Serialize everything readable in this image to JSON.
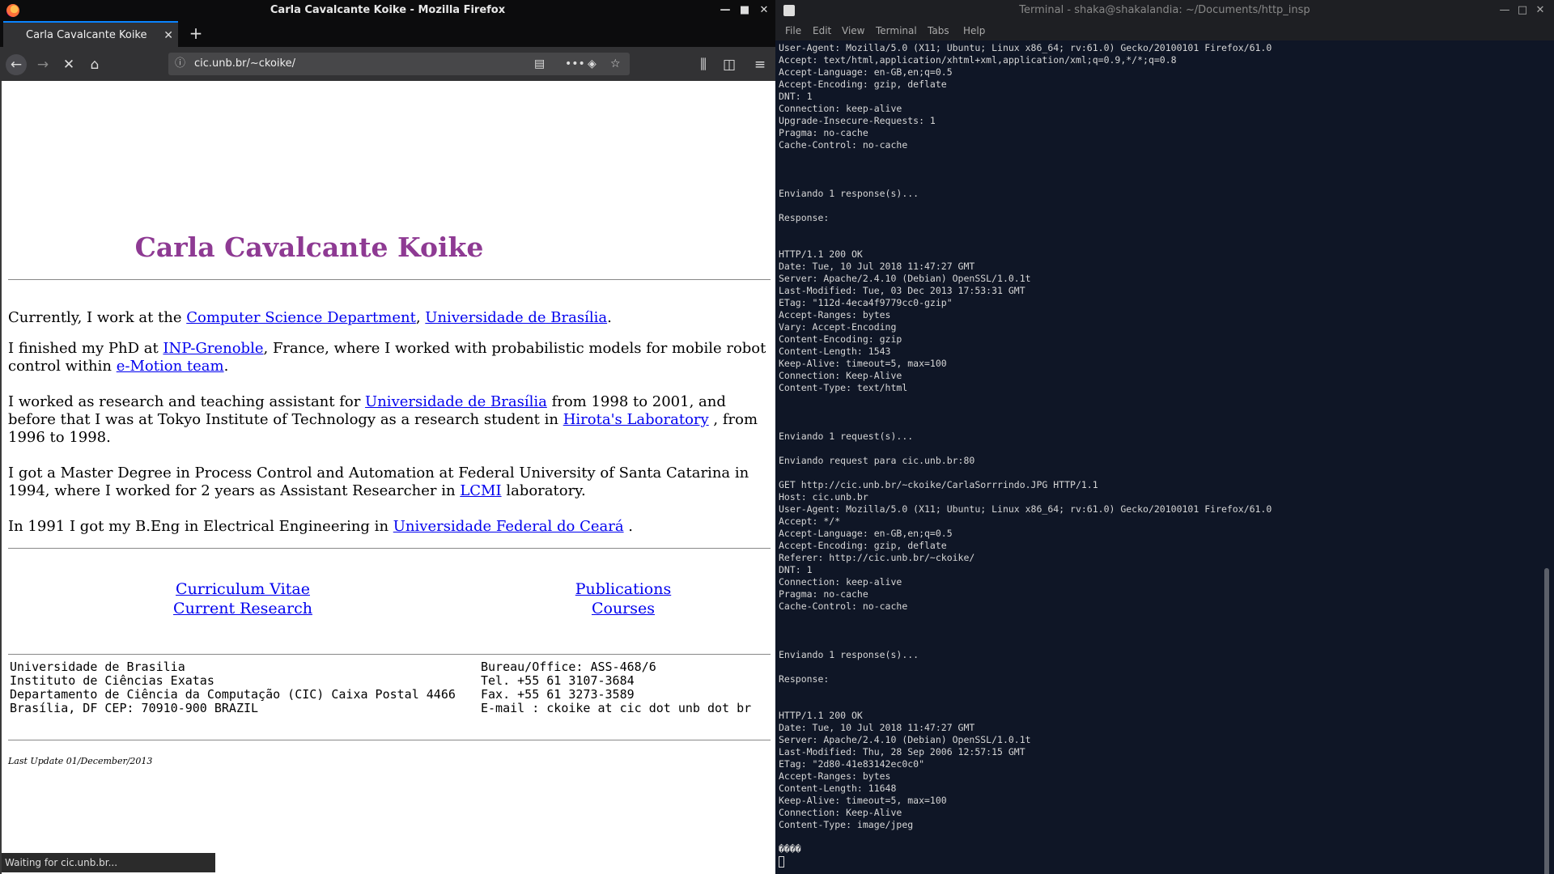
{
  "firefox": {
    "window_title": "Carla Cavalcante Koike - Mozilla Firefox",
    "tab_title": "Carla Cavalcante Koike",
    "url": "cic.unb.br/~ckoike/",
    "status": "Waiting for cic.unb.br..."
  },
  "page": {
    "heading": "Carla Cavalcante Koike",
    "p1": [
      "Currently, I work at the ",
      "Computer Science Department",
      ", ",
      "Universidade de Brasília",
      "."
    ],
    "p2": [
      "I finished my PhD at ",
      "INP-Grenoble",
      ", France, where I worked with probabilistic models for mobile robot control within ",
      "e-Motion team",
      "."
    ],
    "p3": [
      "I worked as research and teaching assistant for ",
      "Universidade de Brasília",
      " from 1998 to 2001, and before that I was at Tokyo Institute of Technology as a research student in ",
      "Hirota's Laboratory",
      " , from 1996 to 1998."
    ],
    "p4": [
      "I got a Master Degree in Process Control and Automation at Federal University of Santa Catarina in 1994, where I worked for 2 years as Assistant Researcher in ",
      "LCMI",
      " laboratory."
    ],
    "p5": [
      "In 1991 I got my B.Eng in Electrical Engineering in ",
      "Universidade Federal do Ceará",
      " ."
    ],
    "links_left": [
      "Curriculum Vitae",
      "Current Research"
    ],
    "links_right": [
      "Publications",
      "Courses"
    ],
    "footer_left": [
      "Universidade de Brasilia",
      "Instituto de Ciências Exatas",
      "Departamento de Ciência da Computação (CIC) Caixa Postal 4466",
      "Brasília, DF CEP: 70910-900 BRAZIL"
    ],
    "footer_right": [
      "Bureau/Office: ASS-468/6",
      "Tel. +55 61 3107-3684",
      "Fax. +55 61 3273-3589",
      "E-mail : ckoike at cic dot unb dot br"
    ],
    "last_update": "Last Update 01/December/2013"
  },
  "terminal": {
    "window_title": "Terminal - shaka@shakalandia: ~/Documents/http_insp",
    "menu": [
      "File",
      "Edit",
      "View",
      "Terminal",
      "Tabs",
      "Help"
    ],
    "lines": [
      "User-Agent: Mozilla/5.0 (X11; Ubuntu; Linux x86_64; rv:61.0) Gecko/20100101 Firefox/61.0",
      "Accept: text/html,application/xhtml+xml,application/xml;q=0.9,*/*;q=0.8",
      "Accept-Language: en-GB,en;q=0.5",
      "Accept-Encoding: gzip, deflate",
      "DNT: 1",
      "Connection: keep-alive",
      "Upgrade-Insecure-Requests: 1",
      "Pragma: no-cache",
      "Cache-Control: no-cache",
      "",
      "",
      "",
      "Enviando 1 response(s)...",
      "",
      "Response:",
      "",
      "",
      "HTTP/1.1 200 OK",
      "Date: Tue, 10 Jul 2018 11:47:27 GMT",
      "Server: Apache/2.4.10 (Debian) OpenSSL/1.0.1t",
      "Last-Modified: Tue, 03 Dec 2013 17:53:31 GMT",
      "ETag: \"112d-4eca4f9779cc0-gzip\"",
      "Accept-Ranges: bytes",
      "Vary: Accept-Encoding",
      "Content-Encoding: gzip",
      "Content-Length: 1543",
      "Keep-Alive: timeout=5, max=100",
      "Connection: Keep-Alive",
      "Content-Type: text/html",
      "",
      "\u001f",
      "",
      "Enviando 1 request(s)...",
      "",
      "Enviando request para cic.unb.br:80",
      "",
      "GET http://cic.unb.br/~ckoike/CarlaSorrrindo.JPG HTTP/1.1",
      "Host: cic.unb.br",
      "User-Agent: Mozilla/5.0 (X11; Ubuntu; Linux x86_64; rv:61.0) Gecko/20100101 Firefox/61.0",
      "Accept: */*",
      "Accept-Language: en-GB,en;q=0.5",
      "Accept-Encoding: gzip, deflate",
      "Referer: http://cic.unb.br/~ckoike/",
      "DNT: 1",
      "Connection: keep-alive",
      "Pragma: no-cache",
      "Cache-Control: no-cache",
      "",
      "",
      "",
      "Enviando 1 response(s)...",
      "",
      "Response:",
      "",
      "",
      "HTTP/1.1 200 OK",
      "Date: Tue, 10 Jul 2018 11:47:27 GMT",
      "Server: Apache/2.4.10 (Debian) OpenSSL/1.0.1t",
      "Last-Modified: Thu, 28 Sep 2006 12:57:15 GMT",
      "ETag: \"2d80-41e83142ec0c0\"",
      "Accept-Ranges: bytes",
      "Content-Length: 11648",
      "Keep-Alive: timeout=5, max=100",
      "Connection: Keep-Alive",
      "Content-Type: image/jpeg",
      "",
      "����"
    ]
  }
}
